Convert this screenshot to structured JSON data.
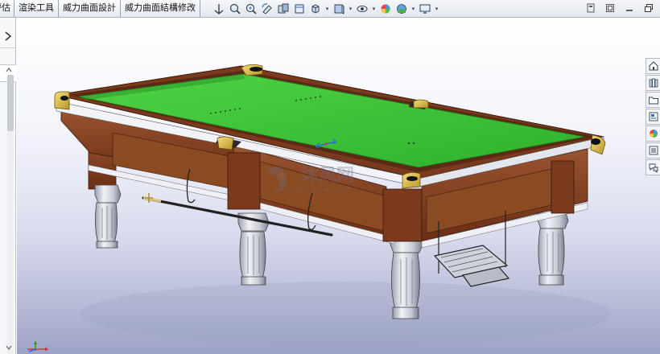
{
  "tabs": [
    {
      "label": "評估",
      "partial": true
    },
    {
      "label": "渲染工具"
    },
    {
      "label": "威力曲面設計"
    },
    {
      "label": "威力曲面結構修改"
    }
  ],
  "heads_up_toolbar": [
    {
      "name": "view-orientation-icon",
      "dropdown": false
    },
    {
      "name": "zoom-to-fit-icon",
      "dropdown": false
    },
    {
      "name": "zoom-to-area-icon",
      "dropdown": false
    },
    {
      "name": "previous-view-icon",
      "dropdown": false
    },
    {
      "name": "section-view-icon",
      "dropdown": false
    },
    {
      "name": "dynamic-annotation-icon",
      "dropdown": false
    },
    {
      "name": "view-orientation-cube-icon",
      "dropdown": true
    },
    {
      "name": "display-style-icon",
      "dropdown": true
    },
    {
      "name": "hide-show-items-icon",
      "dropdown": true
    },
    {
      "name": "edit-appearance-icon",
      "dropdown": false
    },
    {
      "name": "apply-scene-icon",
      "dropdown": true
    },
    {
      "name": "view-settings-icon",
      "dropdown": true
    }
  ],
  "window_controls": [
    "help-icon",
    "window-restore-icon",
    "minimize-icon",
    "maximize-icon"
  ],
  "task_pane": [
    "home-icon",
    "design-library-icon",
    "file-explorer-icon",
    "view-palette-icon",
    "appearances-icon",
    "custom-properties-icon",
    "forum-icon"
  ],
  "watermark": {
    "brand": "沐风网",
    "url": "www.mfcad.com"
  },
  "colors": {
    "felt": "#3fc43a",
    "rail_wood": "#7b3a1e",
    "cabinet_wood": "#8a4a22",
    "corner_pocket": "#e0c34a",
    "accent_blue": "#2b6ed9"
  },
  "model": {
    "name": "snooker-table-3d-model"
  }
}
